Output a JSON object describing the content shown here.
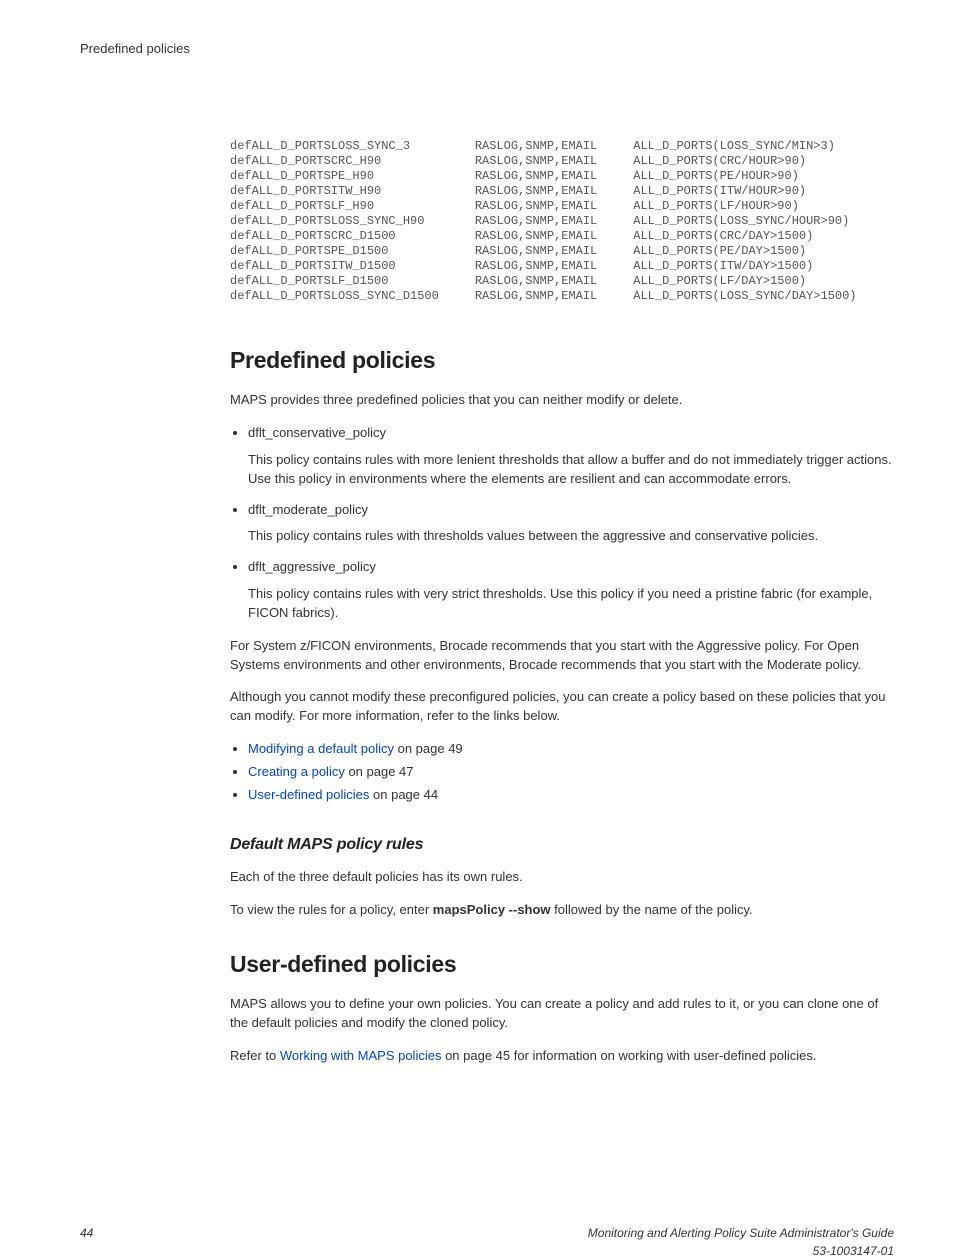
{
  "header": {
    "title": "Predefined policies"
  },
  "code": {
    "rows": [
      {
        "c1": "defALL_D_PORTSLOSS_SYNC_3",
        "c2": "RASLOG,SNMP,EMAIL",
        "c3": "ALL_D_PORTS(LOSS_SYNC/MIN>3)"
      },
      {
        "c1": "defALL_D_PORTSCRC_H90",
        "c2": "RASLOG,SNMP,EMAIL",
        "c3": "ALL_D_PORTS(CRC/HOUR>90)"
      },
      {
        "c1": "defALL_D_PORTSPE_H90",
        "c2": "RASLOG,SNMP,EMAIL",
        "c3": "ALL_D_PORTS(PE/HOUR>90)"
      },
      {
        "c1": "defALL_D_PORTSITW_H90",
        "c2": "RASLOG,SNMP,EMAIL",
        "c3": "ALL_D_PORTS(ITW/HOUR>90)"
      },
      {
        "c1": "defALL_D_PORTSLF_H90",
        "c2": "RASLOG,SNMP,EMAIL",
        "c3": "ALL_D_PORTS(LF/HOUR>90)"
      },
      {
        "c1": "defALL_D_PORTSLOSS_SYNC_H90",
        "c2": "RASLOG,SNMP,EMAIL",
        "c3": "ALL_D_PORTS(LOSS_SYNC/HOUR>90)"
      },
      {
        "c1": "defALL_D_PORTSCRC_D1500",
        "c2": "RASLOG,SNMP,EMAIL",
        "c3": "ALL_D_PORTS(CRC/DAY>1500)"
      },
      {
        "c1": "defALL_D_PORTSPE_D1500",
        "c2": "RASLOG,SNMP,EMAIL",
        "c3": "ALL_D_PORTS(PE/DAY>1500)"
      },
      {
        "c1": "defALL_D_PORTSITW_D1500",
        "c2": "RASLOG,SNMP,EMAIL",
        "c3": "ALL_D_PORTS(ITW/DAY>1500)"
      },
      {
        "c1": "defALL_D_PORTSLF_D1500",
        "c2": "RASLOG,SNMP,EMAIL",
        "c3": "ALL_D_PORTS(LF/DAY>1500)"
      },
      {
        "c1": "defALL_D_PORTSLOSS_SYNC_D1500",
        "c2": "RASLOG,SNMP,EMAIL",
        "c3": "ALL_D_PORTS(LOSS_SYNC/DAY>1500)"
      }
    ]
  },
  "section1": {
    "heading": "Predefined policies",
    "intro": "MAPS provides three predefined policies that you can neither modify or delete.",
    "items": [
      {
        "name": "dflt_conservative_policy",
        "desc": "This policy contains rules with more lenient thresholds that allow a buffer and do not immediately trigger actions. Use this policy in environments where the elements are resilient and can accommodate errors."
      },
      {
        "name": "dflt_moderate_policy",
        "desc": "This policy contains rules with thresholds values between the aggressive and conservative policies."
      },
      {
        "name": "dflt_aggressive_policy",
        "desc": "This policy contains rules with very strict thresholds. Use this policy if you need a pristine fabric (for example, FICON fabrics)."
      }
    ],
    "para2": "For System z/FICON environments, Brocade recommends that you start with the Aggressive policy. For Open Systems environments and other environments, Brocade recommends that you start with the Moderate policy.",
    "para3": "Although you cannot modify these preconfigured policies, you can create a policy based on these policies that you can modify. For more information, refer to the links below.",
    "links": [
      {
        "text": "Modifying a default policy",
        "suffix": " on page 49"
      },
      {
        "text": "Creating a policy",
        "suffix": " on page 47"
      },
      {
        "text": "User-defined policies",
        "suffix": " on page 44"
      }
    ]
  },
  "section2": {
    "heading": "Default MAPS policy rules",
    "p1": "Each of the three default policies has its own rules.",
    "p2a": "To view the rules for a policy, enter ",
    "p2bold": "mapsPolicy --show",
    "p2b": " followed by the name of the policy."
  },
  "section3": {
    "heading": "User-defined policies",
    "p1": "MAPS allows you to define your own policies. You can create a policy and add rules to it, or you can clone one of the default policies and modify the cloned policy.",
    "p2a": "Refer to ",
    "p2link": "Working with MAPS policies",
    "p2b": " on page 45 for information on working with user-defined policies."
  },
  "footer": {
    "page": "44",
    "guide": "Monitoring and Alerting Policy Suite Administrator's Guide",
    "docnum": "53-1003147-01"
  }
}
